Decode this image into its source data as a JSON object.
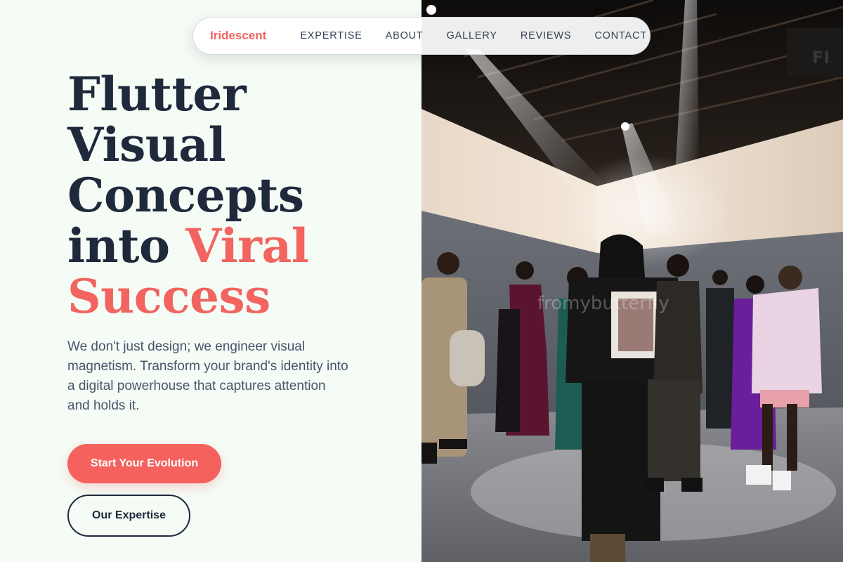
{
  "nav": {
    "brand": "Iridescent",
    "links": [
      "EXPERTISE",
      "ABOUT",
      "GALLERY",
      "REVIEWS",
      "CONTACT"
    ]
  },
  "hero": {
    "headline_lines": [
      "Flutter",
      "Visual",
      "Concepts"
    ],
    "headline_line4_plain": "into ",
    "headline_line4_accent": "Viral",
    "headline_line5_accent": "Success",
    "lead": "We don't just design; we engineer visual magnetism. Transform your brand's identity into a digital powerhouse that captures attention and holds it.",
    "primary_cta": "Start Your Evolution",
    "secondary_cta": "Our Expertise"
  },
  "image": {
    "watermark": "fromybutterfly"
  },
  "colors": {
    "accent": "#f2645f",
    "ink": "#1e293b",
    "background": "#f5fcf6"
  }
}
